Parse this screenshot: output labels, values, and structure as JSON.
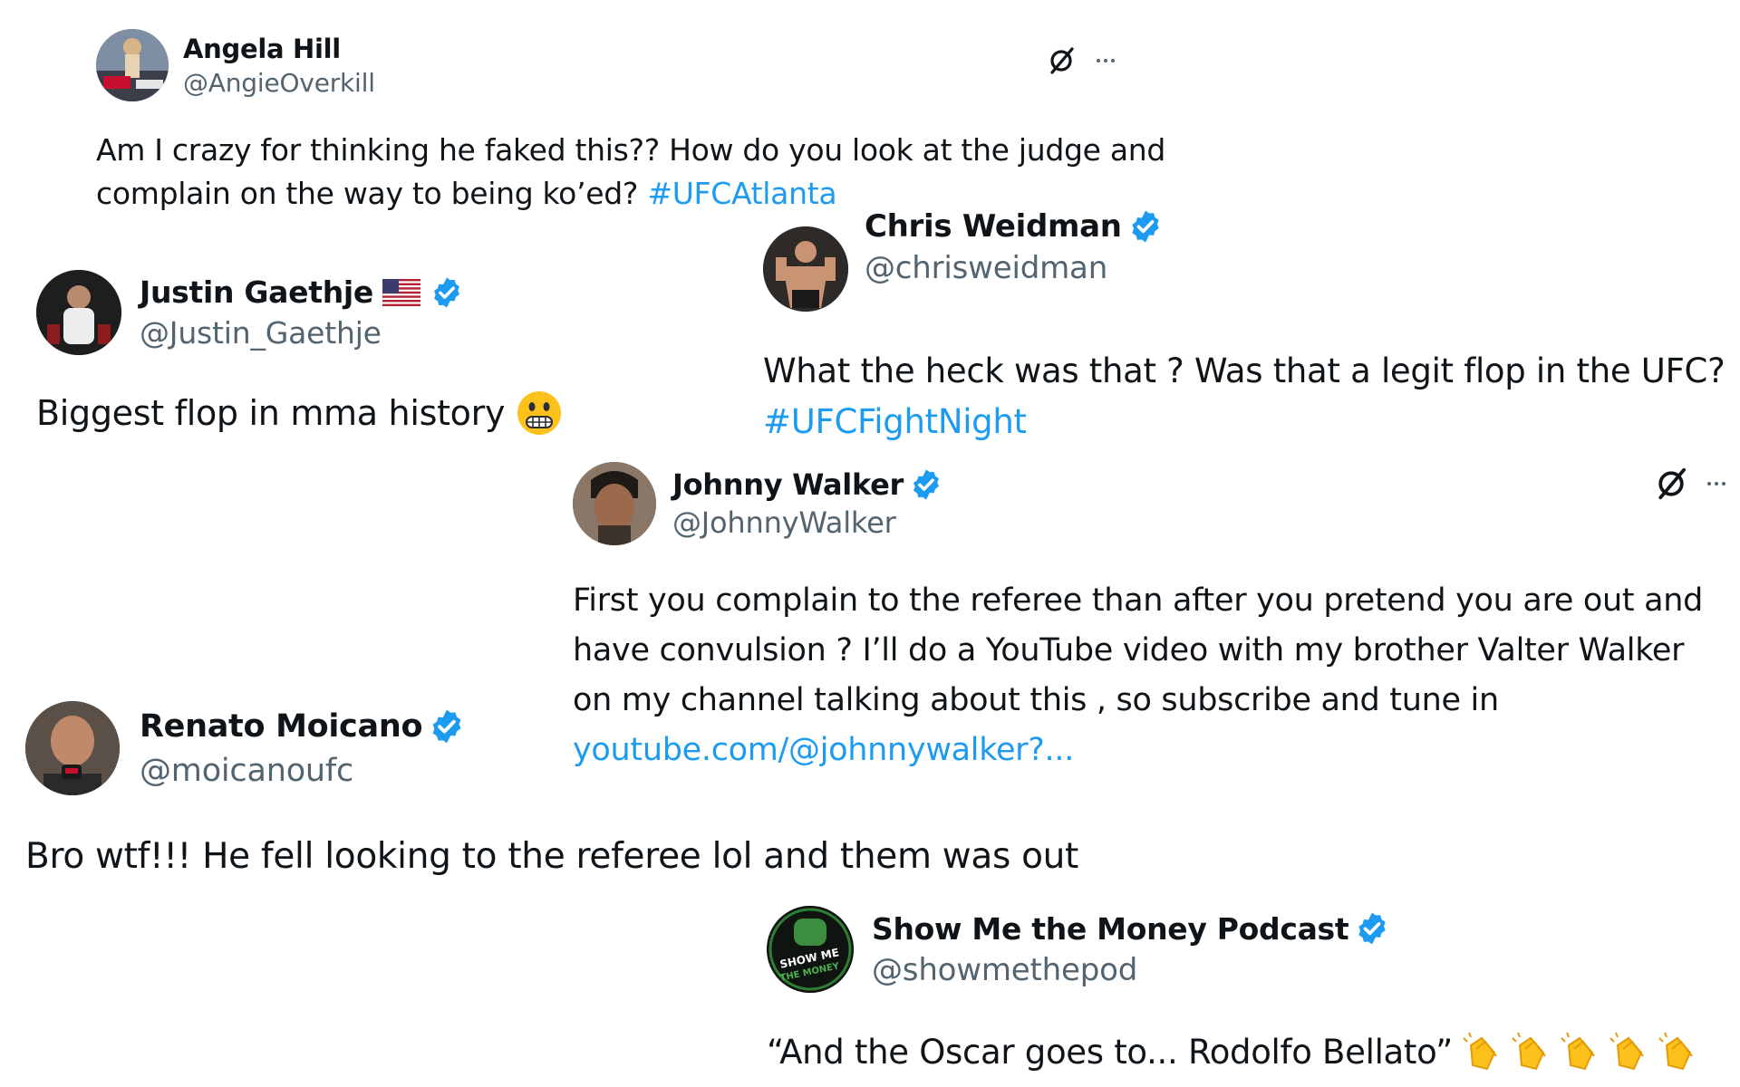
{
  "tweets": [
    {
      "name": "Angela Hill",
      "handle": "@AngieOverkill",
      "verified": false,
      "text_line1": "Am I crazy for thinking he faked this?? How do you look at the judge and",
      "text_line2": "complain on the way to being ko’ed?",
      "hashtag": "#UFCAtlanta"
    },
    {
      "name": "Justin Gaethje",
      "handle": "@Justin_Gaethje",
      "verified": true,
      "text": "Biggest flop in mma history"
    },
    {
      "name": "Chris Weidman",
      "handle": "@chrisweidman",
      "verified": true,
      "text": "What the heck was that ? Was that a legit flop in the UFC?",
      "hashtag": "#UFCFightNight"
    },
    {
      "name": "Johnny Walker",
      "handle": "@JohnnyWalker",
      "verified": true,
      "text_line1": "First you complain to the referee than after you pretend you are out and",
      "text_line2": "have convulsion ? I’ll do a YouTube video with my brother Valter Walker",
      "text_line3": "on my channel talking about this , so subscribe and tune in",
      "link": "youtube.com/@johnnywalker?..."
    },
    {
      "name": "Renato Moicano",
      "handle": "@moicanoufc",
      "verified": true,
      "text": "Bro wtf!!! He fell looking to the referee lol and them was out"
    },
    {
      "name": "Show Me the Money Podcast",
      "handle": "@showmethepod",
      "verified": true,
      "text": "“And the Oscar goes to... Rodolfo Bellato”",
      "avatar_text_line1": "SHOW ME",
      "avatar_text_line2": "THE MONEY"
    }
  ],
  "icons": {
    "grok": "grok-icon",
    "more": "more-icon",
    "verified": "verified-badge-icon",
    "flag": "us-flag-icon",
    "grimace": "grimacing-face-icon",
    "clap": "clapping-hands-icon"
  },
  "colors": {
    "link": "#1d9bf0",
    "verified": "#1d9bf0",
    "handle": "#536471",
    "text": "#0f1419"
  }
}
